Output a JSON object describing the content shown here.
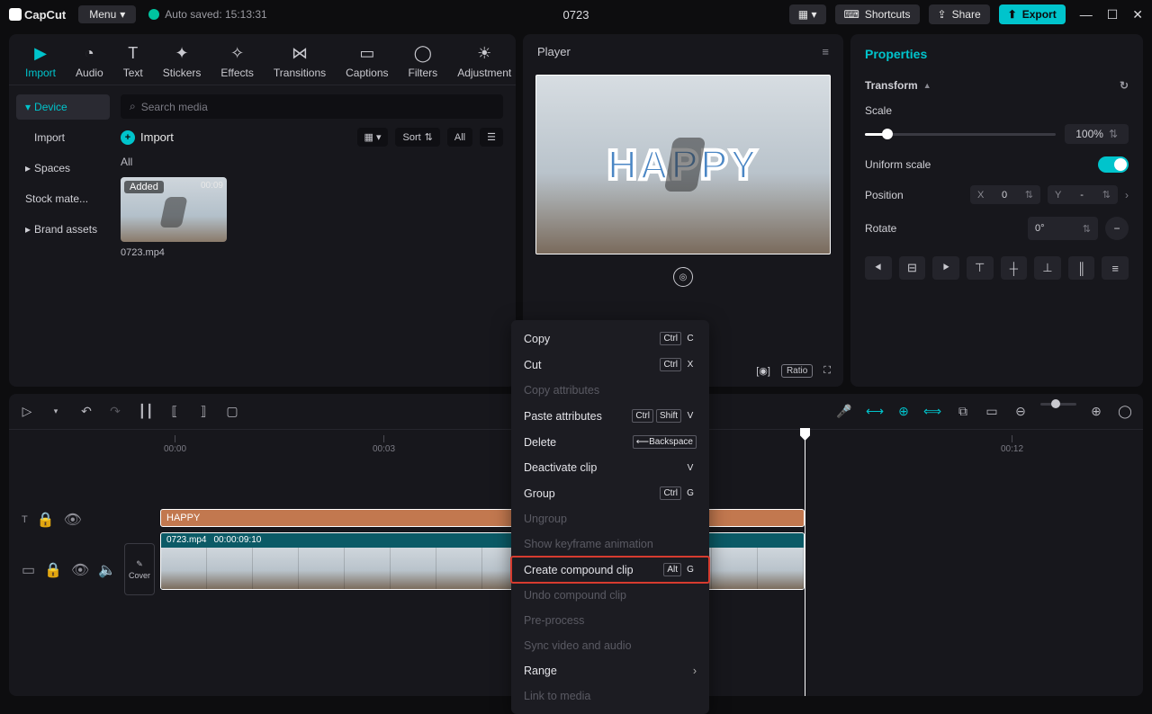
{
  "titlebar": {
    "app": "CapCut",
    "menu": "Menu",
    "autosave": "Auto saved: 15:13:31",
    "project": "0723",
    "shortcuts": "Shortcuts",
    "share": "Share",
    "export": "Export"
  },
  "topTabs": [
    {
      "id": "import",
      "label": "Import"
    },
    {
      "id": "audio",
      "label": "Audio"
    },
    {
      "id": "text",
      "label": "Text"
    },
    {
      "id": "stickers",
      "label": "Stickers"
    },
    {
      "id": "effects",
      "label": "Effects"
    },
    {
      "id": "transitions",
      "label": "Transitions"
    },
    {
      "id": "captions",
      "label": "Captions"
    },
    {
      "id": "filters",
      "label": "Filters"
    },
    {
      "id": "adjustment",
      "label": "Adjustment"
    }
  ],
  "sidenav": {
    "device": "Device",
    "import": "Import",
    "spaces": "Spaces",
    "stock": "Stock mate...",
    "brand": "Brand assets"
  },
  "media": {
    "searchPlaceholder": "Search media",
    "importBtn": "Import",
    "sort": "Sort",
    "all": "All",
    "sectionAll": "All",
    "thumb": {
      "badge": "Added",
      "duration": "00:09",
      "name": "0723.mp4"
    }
  },
  "player": {
    "title": "Player",
    "overlay": "HAPPY",
    "ratio": "Ratio"
  },
  "props": {
    "title": "Properties",
    "transform": "Transform",
    "scale": "Scale",
    "scaleVal": "100%",
    "uniform": "Uniform scale",
    "position": "Position",
    "x": "X",
    "xv": "0",
    "y": "Y",
    "yv": "-",
    "rotate": "Rotate",
    "rv": "0°"
  },
  "timeline": {
    "ticks": [
      "00:00",
      "00:03",
      "00:12"
    ],
    "textClip": "HAPPY",
    "vidName": "0723.mp4",
    "vidDur": "00:00:09:10",
    "cover": "Cover"
  },
  "ctx": {
    "copy": "Copy",
    "cut": "Cut",
    "copyAttr": "Copy attributes",
    "pasteAttr": "Paste attributes",
    "delete": "Delete",
    "deactivate": "Deactivate clip",
    "group": "Group",
    "ungroup": "Ungroup",
    "showKey": "Show keyframe animation",
    "compound": "Create compound clip",
    "undoComp": "Undo compound clip",
    "preproc": "Pre-process",
    "sync": "Sync video and audio",
    "range": "Range",
    "link": "Link to media",
    "kCtrl": "Ctrl",
    "kShift": "Shift",
    "kAlt": "Alt",
    "kBack": "Backspace"
  }
}
